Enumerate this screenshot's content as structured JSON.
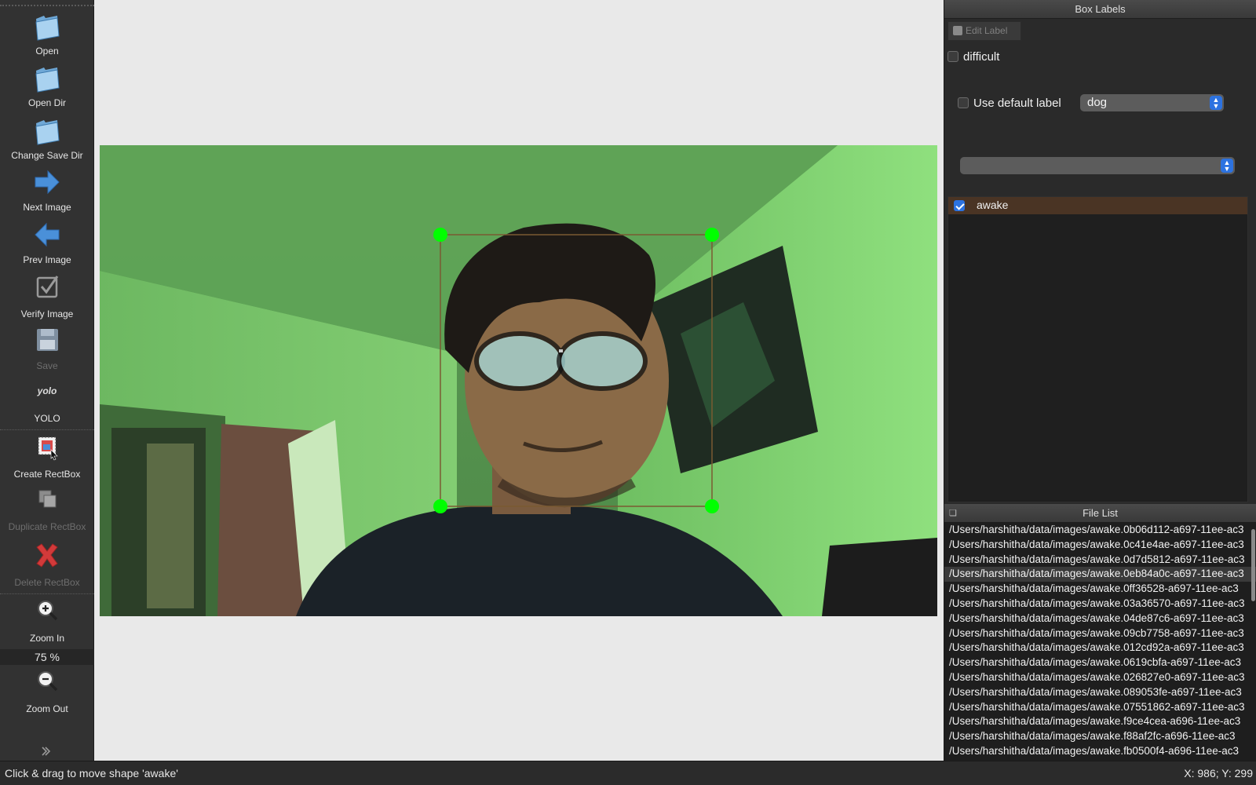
{
  "toolbar": {
    "open": "Open",
    "open_dir": "Open Dir",
    "change_save_dir": "Change Save Dir",
    "next_image": "Next Image",
    "prev_image": "Prev Image",
    "verify_image": "Verify Image",
    "save": "Save",
    "yolo_icon_text": "yolo",
    "yolo": "YOLO",
    "create_rectbox": "Create RectBox",
    "duplicate_rectbox": "Duplicate RectBox",
    "delete_rectbox": "Delete RectBox",
    "zoom_in": "Zoom In",
    "zoom_value": "75 %",
    "zoom_out": "Zoom Out"
  },
  "box_labels": {
    "title": "Box Labels",
    "edit_label": "Edit Label",
    "difficult": "difficult",
    "use_default_label": "Use default label",
    "default_label_value": "dog",
    "label_filter_value": "",
    "labels": [
      {
        "text": "awake",
        "checked": true
      }
    ]
  },
  "file_list": {
    "title": "File List",
    "selected_index": 3,
    "files": [
      "/Users/harshitha/data/images/awake.0b06d112-a697-11ee-ac3",
      "/Users/harshitha/data/images/awake.0c41e4ae-a697-11ee-ac3",
      "/Users/harshitha/data/images/awake.0d7d5812-a697-11ee-ac3",
      "/Users/harshitha/data/images/awake.0eb84a0c-a697-11ee-ac3",
      "/Users/harshitha/data/images/awake.0ff36528-a697-11ee-ac3",
      "/Users/harshitha/data/images/awake.03a36570-a697-11ee-ac3",
      "/Users/harshitha/data/images/awake.04de87c6-a697-11ee-ac3",
      "/Users/harshitha/data/images/awake.09cb7758-a697-11ee-ac3",
      "/Users/harshitha/data/images/awake.012cd92a-a697-11ee-ac3",
      "/Users/harshitha/data/images/awake.0619cbfa-a697-11ee-ac3",
      "/Users/harshitha/data/images/awake.026827e0-a697-11ee-ac3",
      "/Users/harshitha/data/images/awake.089053fe-a697-11ee-ac3",
      "/Users/harshitha/data/images/awake.07551862-a697-11ee-ac3",
      "/Users/harshitha/data/images/awake.f9ce4cea-a696-11ee-ac3",
      "/Users/harshitha/data/images/awake.f88af2fc-a696-11ee-ac3",
      "/Users/harshitha/data/images/awake.fb0500f4-a696-11ee-ac3"
    ]
  },
  "status": {
    "message": "Click & drag to move shape 'awake'",
    "coords": "X: 986; Y: 299"
  },
  "colors": {
    "accent": "#2c72e0",
    "handle": "#00ff00",
    "box_outline": "#7a5a32",
    "selected_label_bg": "#4a3424"
  },
  "icons": [
    "open-folder-icon",
    "arrow-right-icon",
    "arrow-left-icon",
    "checkbox-icon",
    "floppy-disk-icon",
    "yolo-icon",
    "create-rectbox-icon",
    "duplicate-icon",
    "delete-x-icon",
    "zoom-in-icon",
    "zoom-out-icon",
    "handle-icon"
  ]
}
